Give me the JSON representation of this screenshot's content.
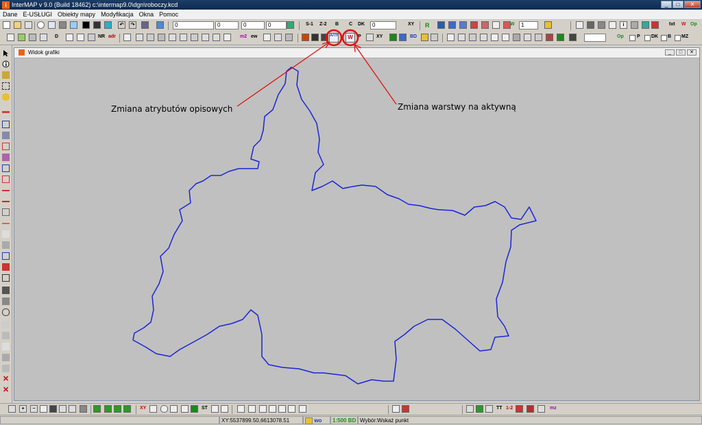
{
  "window": {
    "title": "InterMAP v 9.0 (Build 18462)   c:\\intermap9.0\\dgn\\roboczy.kcd",
    "minimize": "_",
    "maximize": "□",
    "close": "✕"
  },
  "menu": [
    "Dane",
    "E-USŁUGI",
    "Obiekty mapy",
    "Modyfikacja",
    "Okna",
    "Pomoc"
  ],
  "toolbar1": {
    "input_main": "0",
    "input_a": "0",
    "input_b": "0",
    "input_c": "0",
    "label_s1": "S-1",
    "label_z2": "Z-2",
    "label_b": "B",
    "label_c": "C",
    "label_dk": "DK",
    "input_dk": "0",
    "label_xy": "XY",
    "label_r": "R",
    "input_level": "1",
    "label_txt": "txt",
    "label_w": "W",
    "label_op": "Op"
  },
  "toolbar2": {
    "label_d": "D",
    "label_nr": "NR",
    "label_adr": "adr",
    "label_m2": "m2",
    "label_ew": "ew",
    "label_attr_icon": "A/TR",
    "label_layer_icon": "W",
    "label_p": "P",
    "label_xy": "XY",
    "label_bd": "BD",
    "label_op": "Op",
    "check_p": "P",
    "check_dk": "DK",
    "check_b": "B",
    "check_mz": "MZ"
  },
  "graphics_window": {
    "title": "Widok grafiki"
  },
  "annotations": {
    "attr": "Zmiana atrybutów opisowych",
    "layer": "Zmiana warstwy na aktywną"
  },
  "bottom_toolbar": {
    "label_xy": "XY",
    "label_st": "ST",
    "label_tt": "TT",
    "label_12": "1-2",
    "label_mz": "mz"
  },
  "status": {
    "coords": "XY:5537899.50,6613078.51",
    "layer": "wo",
    "scale": "1:500 BD",
    "message": "Wybór:Wskaż punkt"
  },
  "colors": {
    "boundary": "#1a24d6",
    "highlight": "#e01010",
    "canvas": "#c0c0c0"
  }
}
